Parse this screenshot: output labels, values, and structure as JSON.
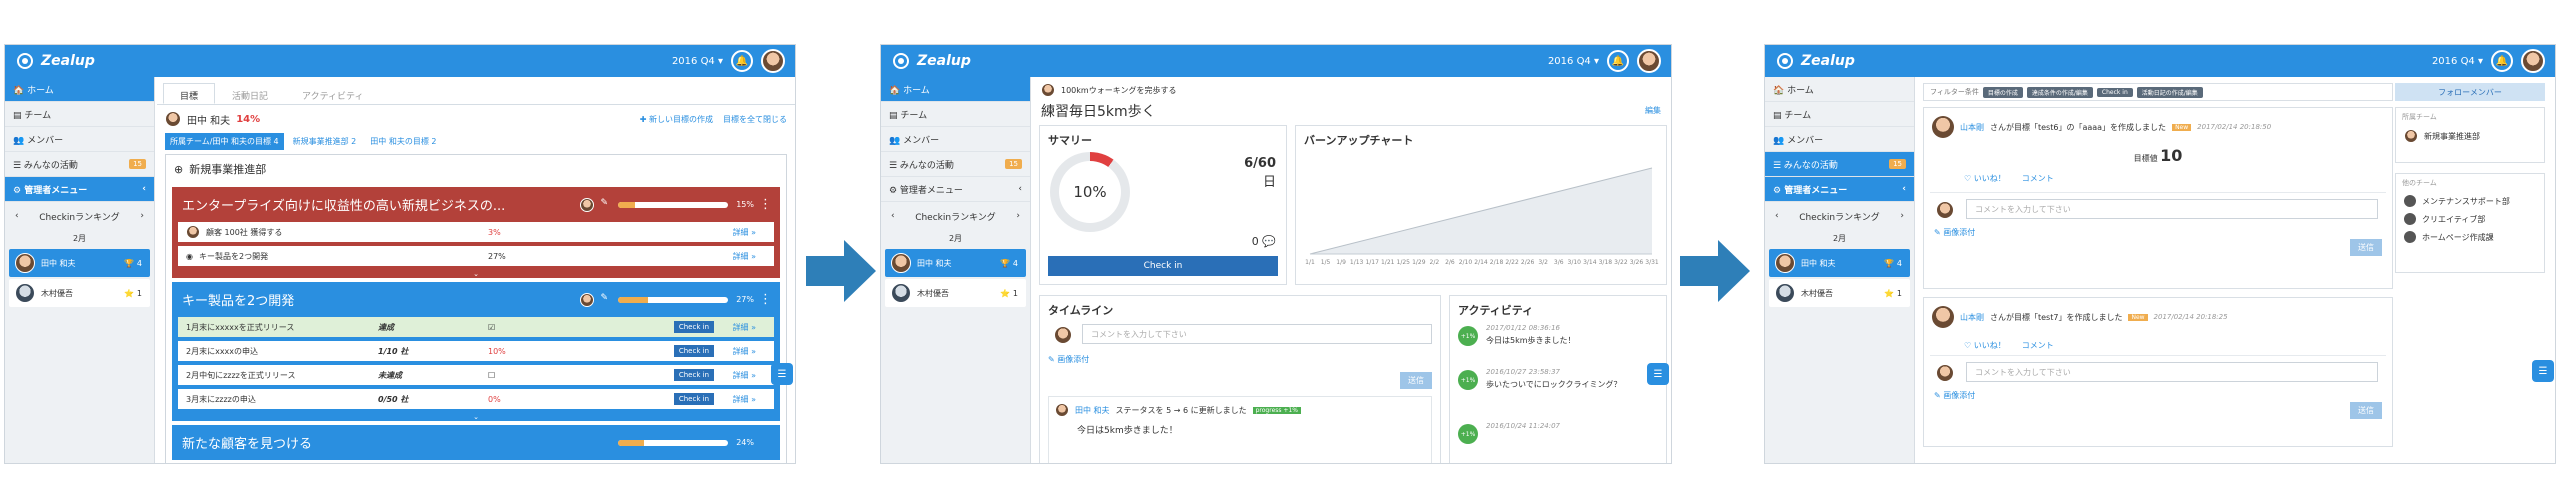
{
  "app": {
    "brand": "Zealup",
    "period": "2016 Q4 ▾",
    "bell": "🔔"
  },
  "sidebar": {
    "items": [
      {
        "label": "🏠 ホーム"
      },
      {
        "label": "▤ チーム"
      },
      {
        "label": "👥 メンバー"
      },
      {
        "label": "☰ みんなの活動",
        "badge": "15"
      },
      {
        "label": "⚙ 管理者メニュー",
        "chevron": "‹"
      }
    ],
    "ranking_title": "Checkinランキング",
    "ranking_prev": "‹",
    "ranking_next": "›",
    "ranking_month": "2月",
    "ranking": [
      {
        "name": "田中 和夫",
        "score": "🏆 4"
      },
      {
        "name": "木村優吾",
        "score": "⭐ 1"
      }
    ]
  },
  "panel1": {
    "tabs": [
      "目標",
      "活動日記",
      "アクティビティ"
    ],
    "user_name": "田中 和夫",
    "user_pct": "14%",
    "link_new": "✚ 新しい目標の作成",
    "link_close": "目標を全て閉じる",
    "subtabs": [
      "所属チーム/田中 和夫の目標 4",
      "新規事業推進部 2",
      "田中 和夫の目標 2"
    ],
    "group_title": "新規事業推進部",
    "cards": [
      {
        "title": "エンタープライズ向けに収益性の高い新規ビジネスの...",
        "pct": "15%",
        "progress": 0.15,
        "color": "#b3413a",
        "more": "詳細 »",
        "rows": [
          {
            "label": "顧客 100社 獲得する",
            "status": "",
            "value": "3%",
            "btn": "",
            "more": "詳細 »"
          },
          {
            "label": "キー製品を2つ開発",
            "status": "",
            "value": "27%",
            "btn": "",
            "more": "詳細 »"
          }
        ]
      },
      {
        "title": "キー製品を2つ開発",
        "pct": "27%",
        "progress": 0.27,
        "color": "#2a8fe0",
        "more": "詳細 »",
        "rows": [
          {
            "label": "1月末にxxxxxを正式リリース",
            "status": "達成",
            "value": "☑",
            "btn": "Check in",
            "more": "詳細 »",
            "done": true
          },
          {
            "label": "2月末にxxxxの申込",
            "status": "1/10 社",
            "value": "10%",
            "btn": "Check in",
            "more": "詳細 »"
          },
          {
            "label": "2月中旬にzzzzを正式リリース",
            "status": "未達成",
            "value": "☐",
            "btn": "Check in",
            "more": "詳細 »"
          },
          {
            "label": "3月末にzzzzの申込",
            "status": "0/50 社",
            "value": "0%",
            "btn": "Check in",
            "more": "詳細 »"
          }
        ]
      },
      {
        "title": "新たな顧客を見つける",
        "pct": "24%",
        "progress": 0.24,
        "color": "#2a8fe0",
        "more": "",
        "rows": []
      }
    ]
  },
  "panel2": {
    "owner": "100kmウォーキングを完歩する",
    "title": "練習毎日5km歩く",
    "edit": "編集",
    "summary_title": "サマリー",
    "summary_pct": "10%",
    "summary_progress": 0.1,
    "summary_count": "6/60",
    "summary_unit": "日",
    "summary_comments": "0 💬",
    "checkin": "Check in",
    "burnup_title": "バーンアップチャート",
    "burnup_dates": [
      "1/1",
      "1/5",
      "1/9",
      "1/13",
      "1/17",
      "1/21",
      "1/25",
      "1/29",
      "2/2",
      "2/6",
      "2/10",
      "2/14",
      "2/18",
      "2/22",
      "2/26",
      "3/2",
      "3/6",
      "3/10",
      "3/14",
      "3/18",
      "3/22",
      "3/26",
      "3/31"
    ],
    "timeline_title": "タイムライン",
    "timeline_placeholder": "コメントを入力して下さい",
    "image_attach": "✎ 画像添付",
    "post": "送信",
    "timeline_entry_user": "田中 和夫",
    "timeline_entry_text": "ステータスを 5 → 6 に更新しました",
    "timeline_entry_badge": "progress +1%",
    "timeline_entry_body": "今日は5km歩きました！",
    "activity_title": "アクティビティ",
    "activities": [
      {
        "badge": "+1%",
        "time": "2017/01/12 08:36:16",
        "text": "今日は5km歩きました！"
      },
      {
        "badge": "+1%",
        "time": "2016/10/27 23:58:37",
        "text": "歩いたついでにロッククライミング？"
      },
      {
        "badge": "+1%",
        "time": "2016/10/24 11:24:07",
        "text": ""
      }
    ]
  },
  "panel3": {
    "filter_label": "フィルター条件",
    "filters": [
      "目標の作成",
      "達成条件の作成/編集",
      "Check in",
      "活動日記の作成/編集"
    ],
    "follow_members": "フォローメンバー",
    "feed": [
      {
        "user": "山本剛",
        "text": "さんが目標「test6」の「aaaa」を作成しました",
        "tag": "New",
        "time": "2017/02/14 20:18:50",
        "metric_label": "目標値",
        "metric_value": "10",
        "like": "♡ いいね！",
        "comment": "コメント",
        "placeholder": "コメントを入力して下さい",
        "attach": "✎ 画像添付",
        "post": "送信"
      },
      {
        "user": "山本剛",
        "text": "さんが目標「test7」を作成しました",
        "tag": "New",
        "time": "2017/02/14 20:18:25",
        "like": "♡ いいね！",
        "comment": "コメント",
        "placeholder": "コメントを入力して下さい",
        "attach": "✎ 画像添付",
        "post": "送信"
      }
    ],
    "own_team_label": "所属チーム",
    "own_teams": [
      "新規事業推進部"
    ],
    "other_team_label": "他のチーム",
    "other_teams": [
      "メンテナンスサポート部",
      "クリエイティブ部",
      "ホームページ作成課"
    ]
  }
}
